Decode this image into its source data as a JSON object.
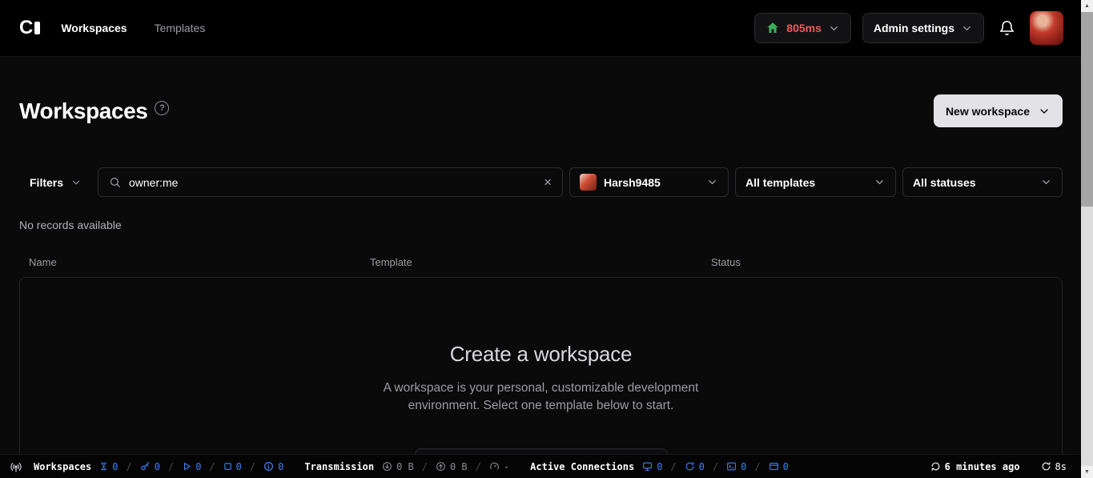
{
  "navbar": {
    "nav_items": [
      {
        "label": "Workspaces"
      },
      {
        "label": "Templates"
      }
    ],
    "latency_button": {
      "value": "805ms"
    },
    "admin_button": {
      "label": "Admin settings"
    }
  },
  "page_header": {
    "title": "Workspaces",
    "help_glyph": "?",
    "new_workspace_button": "New workspace"
  },
  "filter_bar": {
    "filters_button": "Filters",
    "search": {
      "value": "owner:me",
      "clear_glyph": "×"
    },
    "owner_dropdown": "Harsh9485",
    "template_dropdown": "All templates",
    "status_dropdown": "All statuses"
  },
  "table": {
    "no_records": "No records available",
    "columns": [
      {
        "label": "Name"
      },
      {
        "label": "Template"
      },
      {
        "label": "Status"
      }
    ],
    "empty_state": {
      "title": "Create a workspace",
      "description": "A workspace is your personal, customizable development environment. Select one template below to start."
    }
  },
  "status_bar": {
    "separator": "/",
    "workspaces": {
      "label": "Workspaces",
      "counts": [
        {
          "icon": "hourglass-icon",
          "value": "0"
        },
        {
          "icon": "key-icon",
          "value": "0"
        },
        {
          "icon": "play-icon",
          "value": "0"
        },
        {
          "icon": "stop-square-icon",
          "value": "0"
        },
        {
          "icon": "info-circle-icon",
          "value": "0"
        }
      ]
    },
    "transmission": {
      "label": "Transmission",
      "download": "0 B",
      "upload": "0 B",
      "latency": "-"
    },
    "active_connections": {
      "label": "Active Connections",
      "counts": [
        {
          "icon": "vscode-icon",
          "value": "0"
        },
        {
          "icon": "reconnect-icon",
          "value": "0"
        },
        {
          "icon": "terminal-icon",
          "value": "0"
        },
        {
          "icon": "window-icon",
          "value": "0"
        }
      ]
    },
    "last_refresh": "6 minutes ago",
    "refresh_interval": "8s"
  },
  "scrollbar": {
    "up_glyph": "▲",
    "down_glyph": "▼"
  },
  "colors": {
    "latency_red": "#f25a5a",
    "count_blue": "#3b82f6",
    "proxy_green": "#3fae5a",
    "new_workspace_bg": "#e3e3e7"
  }
}
